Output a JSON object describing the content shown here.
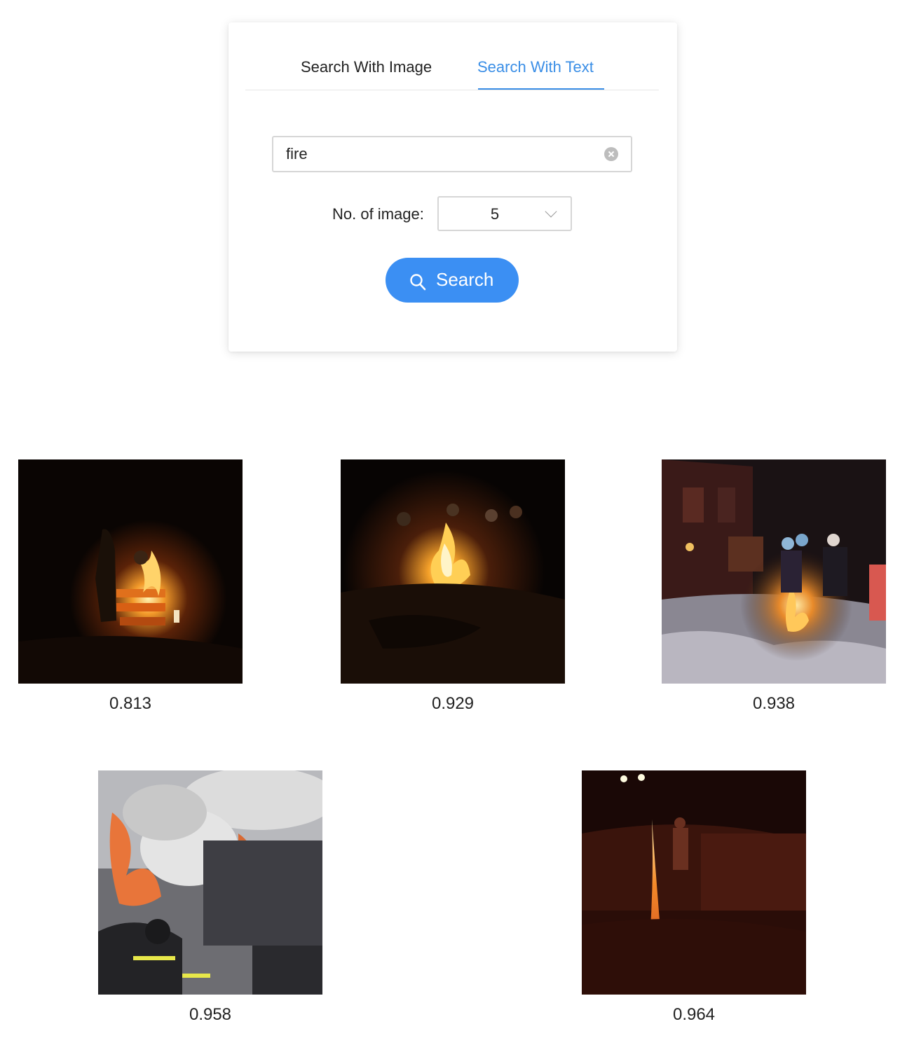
{
  "tabs": {
    "image_label": "Search With Image",
    "text_label": "Search With Text",
    "active": "Search With Text"
  },
  "search": {
    "value": "fire"
  },
  "count": {
    "label": "No. of image:",
    "selected": "5"
  },
  "search_button": {
    "label": "Search"
  },
  "results": [
    {
      "score": "0.813",
      "scene": "person-beside-campfire-at-night"
    },
    {
      "score": "0.929",
      "scene": "group-around-campfire-at-night"
    },
    {
      "score": "0.938",
      "scene": "people-around-fire-in-snow"
    },
    {
      "score": "0.958",
      "scene": "firefighters-house-fire-smoke"
    },
    {
      "score": "0.964",
      "scene": "firework-fountain-crowd"
    }
  ],
  "colors": {
    "accent": "#3a8ee6",
    "button": "#3b8ff3",
    "border": "#d6d6d6",
    "text": "#222222"
  }
}
